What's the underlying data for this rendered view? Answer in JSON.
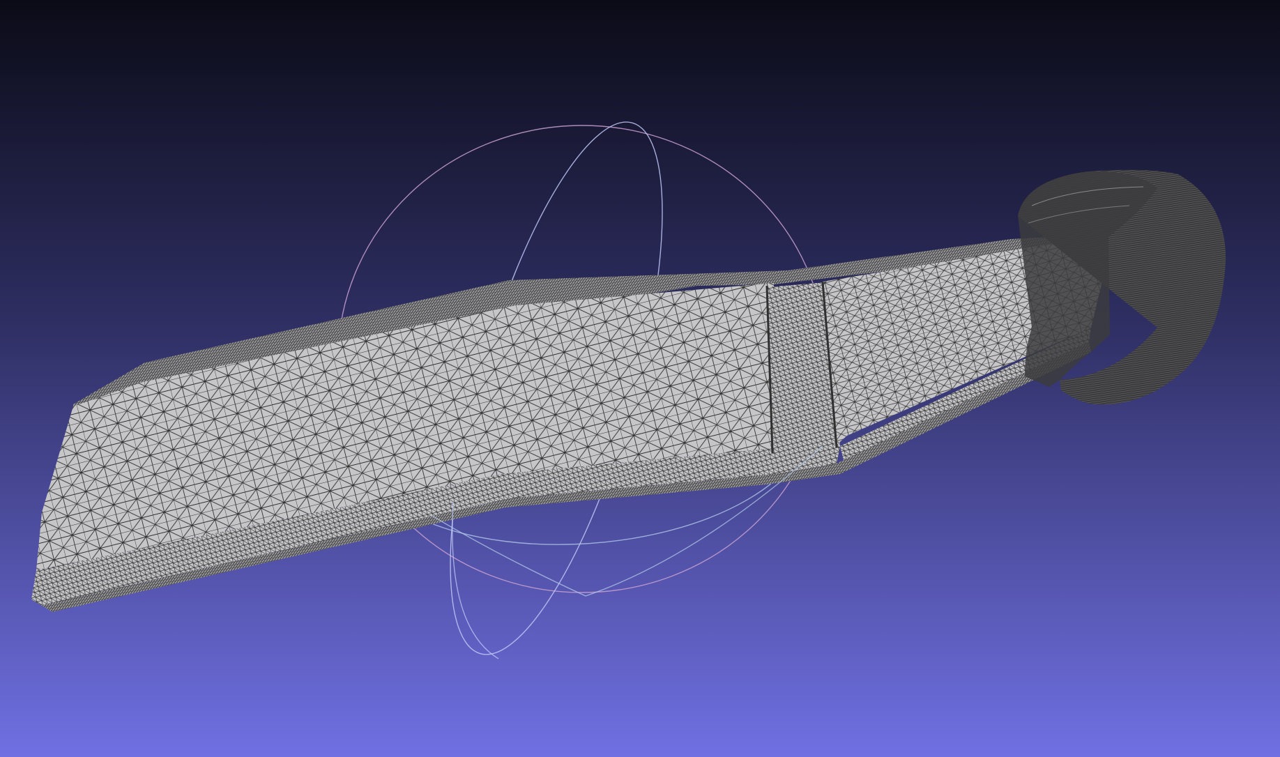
{
  "viewer": {
    "background": {
      "top": "#0b0b17",
      "middle": "#2e2e62",
      "bottom": "#7070e3"
    },
    "mesh": {
      "render_mode": "wireframe-flat",
      "fill": "#c6c6c8",
      "fill_dark": "#9a9a9e",
      "edge_color": "#303030",
      "cap_color": "#3c3c3e"
    },
    "trackball": {
      "ring_x_color": "#c8a0d0",
      "ring_y_color": "#c0c8f8",
      "ring_z_color": "#b0c8e8"
    }
  }
}
